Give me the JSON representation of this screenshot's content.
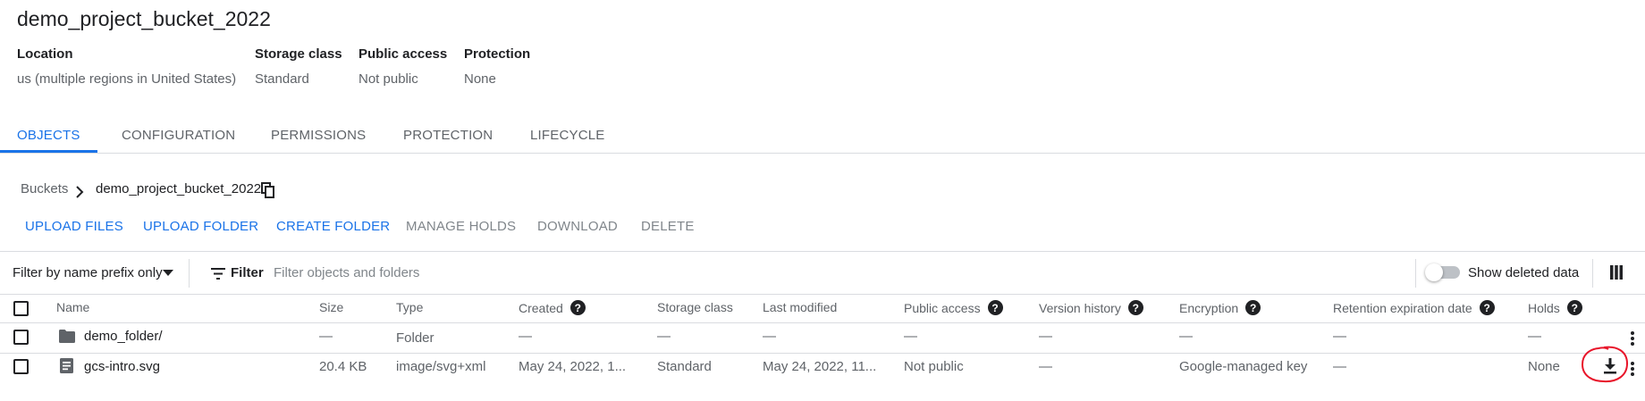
{
  "bucket": {
    "title": "demo_project_bucket_2022",
    "meta": [
      {
        "label": "Location",
        "value": "us (multiple regions in United States)"
      },
      {
        "label": "Storage class",
        "value": "Standard"
      },
      {
        "label": "Public access",
        "value": "Not public"
      },
      {
        "label": "Protection",
        "value": "None"
      }
    ]
  },
  "tabs": [
    "OBJECTS",
    "CONFIGURATION",
    "PERMISSIONS",
    "PROTECTION",
    "LIFECYCLE"
  ],
  "active_tab": "OBJECTS",
  "breadcrumb": {
    "root": "Buckets",
    "current": "demo_project_bucket_2022"
  },
  "actions": {
    "upload_files": "UPLOAD FILES",
    "upload_folder": "UPLOAD FOLDER",
    "create_folder": "CREATE FOLDER",
    "manage_holds": "MANAGE HOLDS",
    "download": "DOWNLOAD",
    "delete": "DELETE"
  },
  "filter_bar": {
    "mode": "Filter by name prefix only",
    "filter_label": "Filter",
    "placeholder": "Filter objects and folders",
    "show_deleted": "Show deleted data",
    "show_deleted_on": false
  },
  "table": {
    "columns": [
      "Name",
      "Size",
      "Type",
      "Created",
      "Storage class",
      "Last modified",
      "Public access",
      "Version history",
      "Encryption",
      "Retention expiration date",
      "Holds"
    ],
    "rows": [
      {
        "name": "demo_folder/",
        "icon": "folder-icon",
        "size": "—",
        "type": "Folder",
        "created": "—",
        "storage_class": "—",
        "last_modified": "—",
        "public_access": "—",
        "version_history": "—",
        "encryption": "—",
        "retention": "—",
        "holds": "—"
      },
      {
        "name": "gcs-intro.svg",
        "icon": "file-icon",
        "size": "20.4 KB",
        "type": "image/svg+xml",
        "created": "May 24, 2022, 1...",
        "storage_class": "Standard",
        "last_modified": "May 24, 2022, 11...",
        "public_access": "Not public",
        "version_history": "—",
        "encryption": "Google-managed key",
        "retention": "—",
        "holds": "None"
      }
    ]
  },
  "colors": {
    "accent": "#1a73e8",
    "annotation": "#e8152a"
  },
  "icons": [
    "copy-icon",
    "chevron-right-icon",
    "filter-icon",
    "columns-icon",
    "folder-icon",
    "file-icon",
    "download-icon",
    "more-vert-icon",
    "help-icon"
  ]
}
